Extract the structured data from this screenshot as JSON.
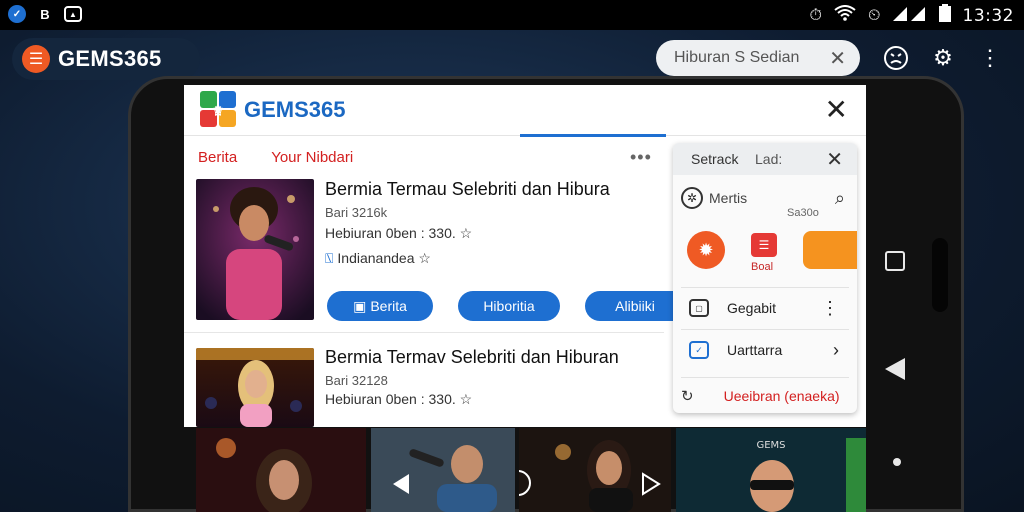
{
  "status_bar": {
    "time": "13:32"
  },
  "browser": {
    "brand": "GEMS365",
    "search": {
      "value": "Hiburan S Sedian"
    }
  },
  "app": {
    "title": "GEMS365",
    "tabs": [
      "Berita",
      "Your Nibdari"
    ],
    "cards": [
      {
        "title": "Bermia Termau Selebriti dan Hibura",
        "line1": "Bari 3216k",
        "line2": "Hebiuran 0ben : 330. ☆",
        "line3": "Indianandea ☆",
        "buttons": [
          "Berita",
          "Hiboritia",
          "Alibiiki"
        ]
      },
      {
        "title": "Bermia Termav Selebriti dan Hiburan",
        "line1": "Bari 32128",
        "line2": "Hebiuran 0ben : 330. ☆"
      }
    ]
  },
  "panel": {
    "header_left": "Setrack",
    "header_mid": "Lad:",
    "search_label": "Mertis",
    "search_sub": "Sa30o",
    "quick_label": "Boal",
    "items": [
      "Gegabit",
      "Uarttarra"
    ],
    "footer": "Ueeibran (enaeka)"
  },
  "colors": {
    "accent_blue": "#1e6fd1",
    "accent_orange": "#ef5a24",
    "tab_red": "#d32020"
  }
}
